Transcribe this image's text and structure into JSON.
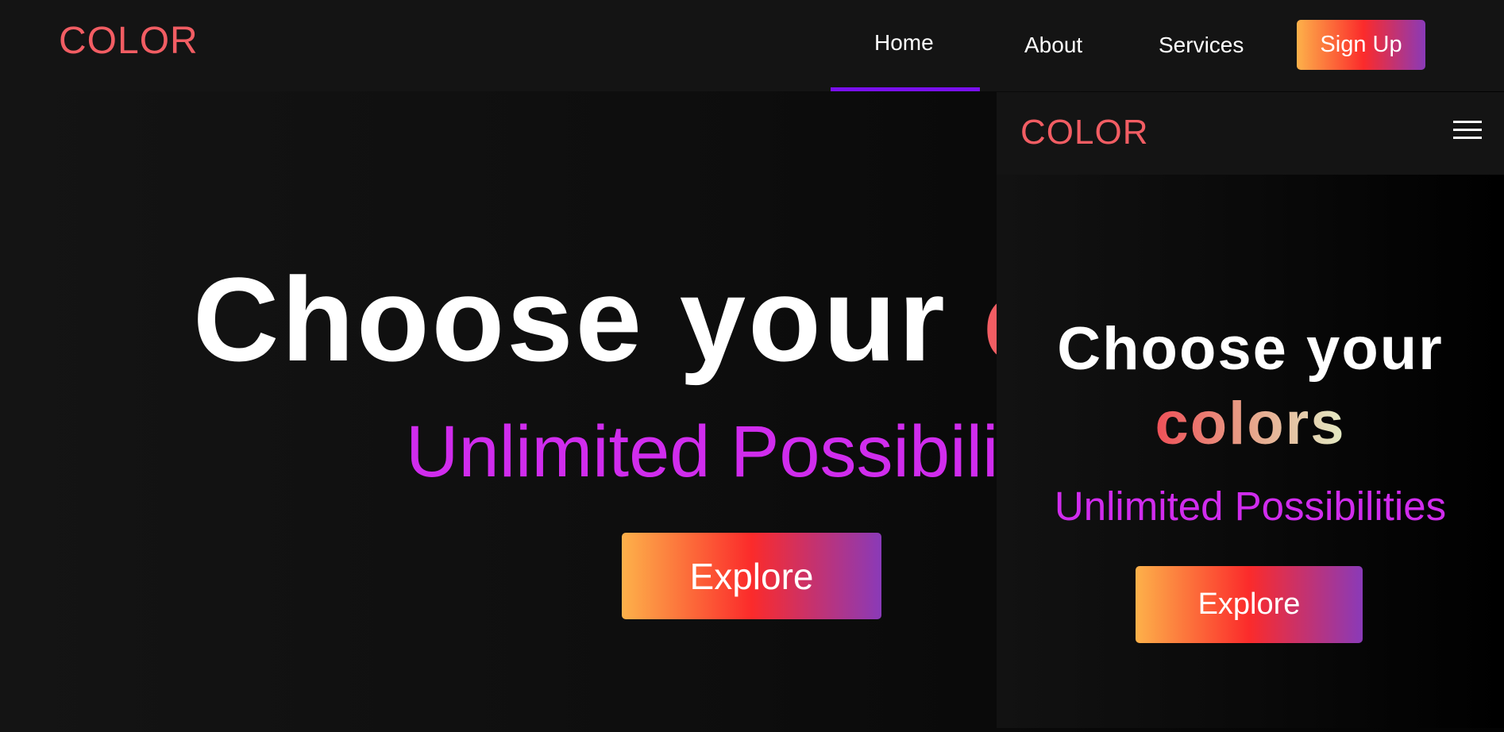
{
  "colors": {
    "logo": "#f25d63",
    "nav_active_underline": "#7a10ee",
    "subtitle": "#d02ced",
    "background": "#141414",
    "button_gradient": [
      "#fdb14a",
      "#fb2b2b",
      "#8a3ab8"
    ],
    "accent_word_gradient": [
      "#ee4f57",
      "#e7a48a",
      "#e3ecc5"
    ]
  },
  "desktop": {
    "logo": "COLOR",
    "nav": {
      "items": [
        {
          "label": "Home",
          "active": true
        },
        {
          "label": "About",
          "active": false
        },
        {
          "label": "Services",
          "active": false
        }
      ],
      "signup_label": "Sign Up"
    },
    "hero": {
      "title_prefix": "Choose your ",
      "title_accent": "c",
      "subtitle": "Unlimited Possibilit",
      "explore_label": "Explore"
    }
  },
  "mobile": {
    "logo": "COLOR",
    "menu_icon": "hamburger-icon",
    "hero": {
      "title_line1": "Choose your",
      "title_line2": "colors",
      "subtitle": "Unlimited Possibilities",
      "explore_label": "Explore"
    }
  }
}
